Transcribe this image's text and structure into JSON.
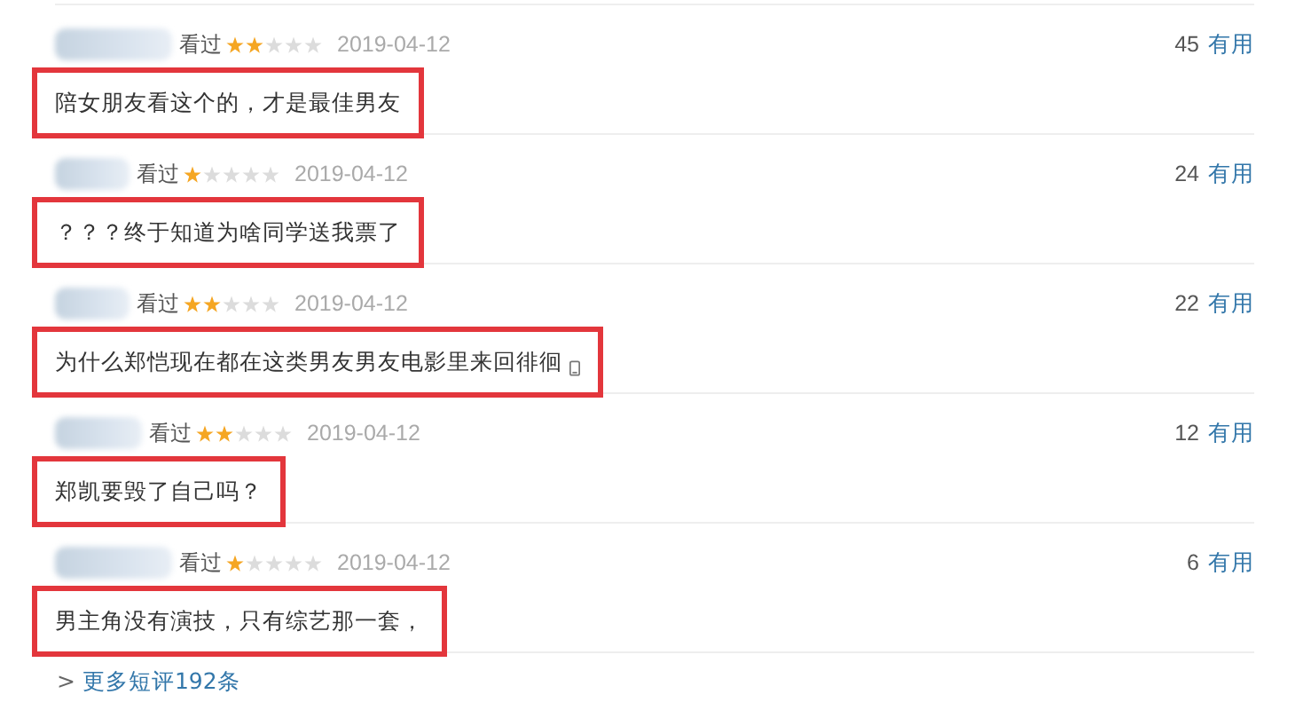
{
  "comments": [
    {
      "watched": "看过",
      "stars": 2,
      "date": "2019-04-12",
      "votes": "45",
      "useful": "有用",
      "text": "陪女朋友看这个的，才是最佳男友",
      "highlighted": true
    },
    {
      "watched": "看过",
      "stars": 1,
      "date": "2019-04-12",
      "votes": "24",
      "useful": "有用",
      "text": "？？？终于知道为啥同学送我票了",
      "highlighted": true
    },
    {
      "watched": "看过",
      "stars": 2,
      "date": "2019-04-12",
      "votes": "22",
      "useful": "有用",
      "text": "为什么郑恺现在都在这类男友男友电影里来回徘徊",
      "highlighted": true,
      "mobile": true
    },
    {
      "watched": "看过",
      "stars": 2,
      "date": "2019-04-12",
      "votes": "12",
      "useful": "有用",
      "text": "郑凯要毁了自己吗？",
      "highlighted": true
    },
    {
      "watched": "看过",
      "stars": 1,
      "date": "2019-04-12",
      "votes": "6",
      "useful": "有用",
      "text": "男主角没有演技，只有综艺那一套，",
      "highlighted": true
    }
  ],
  "more": {
    "arrow": ">",
    "link": "更多短评192条"
  }
}
